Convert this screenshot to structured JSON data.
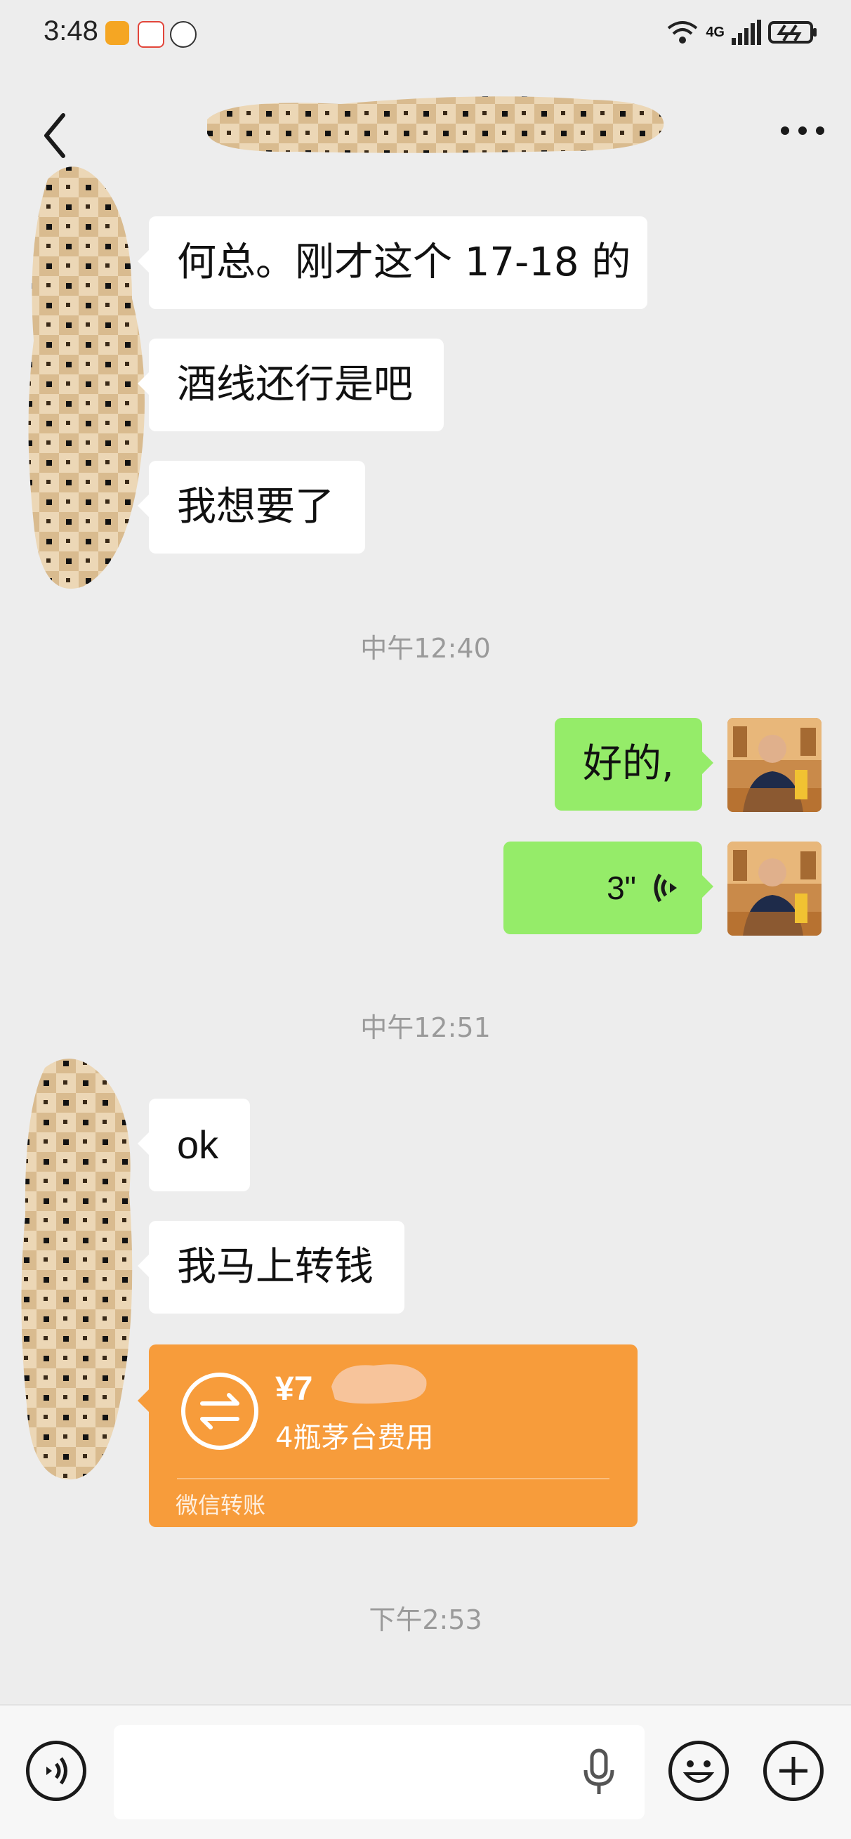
{
  "status_bar": {
    "time": "3:48",
    "network": "4G",
    "sim": "6"
  },
  "chat": {
    "messages_left_1": [
      "何总。刚才这个 17-18 的",
      "酒线还行是吧",
      "我想要了"
    ],
    "timestamp_1": "中午12:40",
    "reply_text": "好的,",
    "voice_duration": "3\"",
    "timestamp_2": "中午12:51",
    "messages_left_2": [
      "ok",
      "我马上转钱"
    ],
    "transfer": {
      "amount": "¥7",
      "note": "4瓶茅台费用",
      "label": "微信转账"
    },
    "timestamp_3": "下午2:53"
  },
  "colors": {
    "background": "#ededed",
    "sent_bubble": "#95ec69",
    "transfer_card": "#f79c3b"
  },
  "icons": [
    "back-icon",
    "more-icon",
    "voice-toggle-icon",
    "microphone-icon",
    "emoji-icon",
    "plus-icon",
    "transfer-arrows-icon",
    "voice-wave-icon"
  ]
}
